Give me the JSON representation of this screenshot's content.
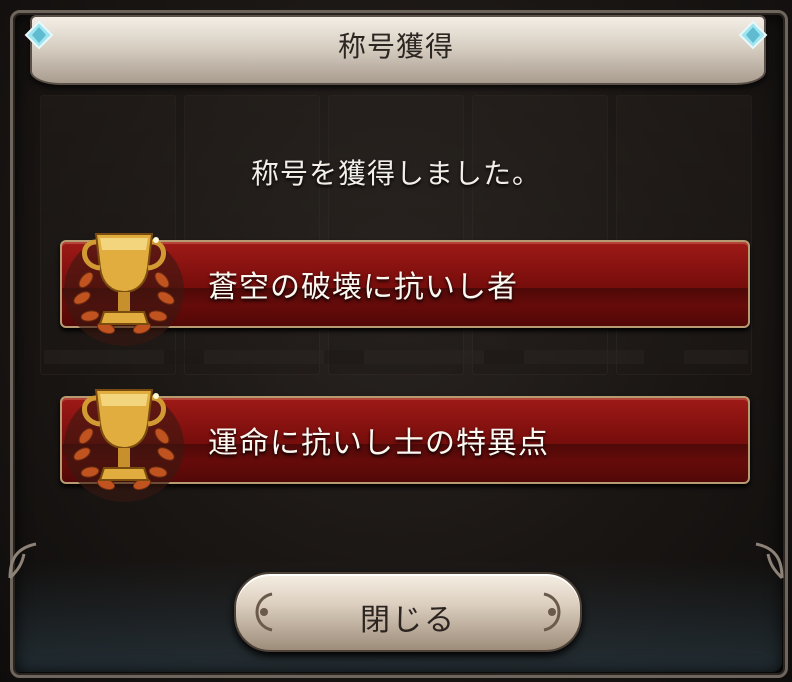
{
  "header": {
    "title": "称号獲得"
  },
  "message": "称号を獲得しました。",
  "titles": [
    {
      "label": "蒼空の破壊に抗いし者",
      "icon": "trophy-icon"
    },
    {
      "label": "運命に抗いし士の特異点",
      "icon": "trophy-icon"
    }
  ],
  "close_button": {
    "label": "閉じる"
  },
  "colors": {
    "title_bar": "#e6ddd1",
    "ribbon": "#8a1310",
    "ribbon_border": "#b69a72",
    "text_light": "#f2efe9",
    "gold": "#d9a641",
    "gem": "#9fe4ef"
  }
}
